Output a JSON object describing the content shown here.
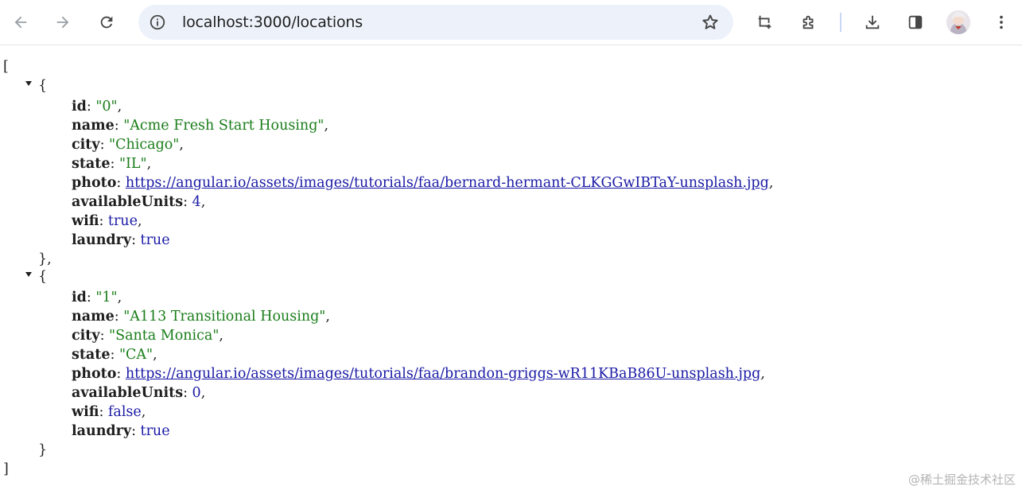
{
  "browser": {
    "url": "localhost:3000/locations"
  },
  "json": {
    "open_bracket": "[",
    "close_bracket": "]",
    "open_brace": "{",
    "close_brace_comma": "},",
    "close_brace": "}",
    "items": [
      {
        "keys": {
          "id": "id",
          "name": "name",
          "city": "city",
          "state": "state",
          "photo": "photo",
          "availableUnits": "availableUnits",
          "wifi": "wifi",
          "laundry": "laundry"
        },
        "id": "\"0\"",
        "name": "\"Acme Fresh Start Housing\"",
        "city": "\"Chicago\"",
        "state": "\"IL\"",
        "photo": "https://angular.io/assets/images/tutorials/faa/bernard-hermant-CLKGGwIBTaY-unsplash.jpg",
        "availableUnits": "4",
        "wifi": "true",
        "laundry": "true"
      },
      {
        "keys": {
          "id": "id",
          "name": "name",
          "city": "city",
          "state": "state",
          "photo": "photo",
          "availableUnits": "availableUnits",
          "wifi": "wifi",
          "laundry": "laundry"
        },
        "id": "\"1\"",
        "name": "\"A113 Transitional Housing\"",
        "city": "\"Santa Monica\"",
        "state": "\"CA\"",
        "photo": "https://angular.io/assets/images/tutorials/faa/brandon-griggs-wR11KBaB86U-unsplash.jpg",
        "availableUnits": "0",
        "wifi": "false",
        "laundry": "true"
      }
    ]
  },
  "watermark": "@稀土掘金技术社区"
}
